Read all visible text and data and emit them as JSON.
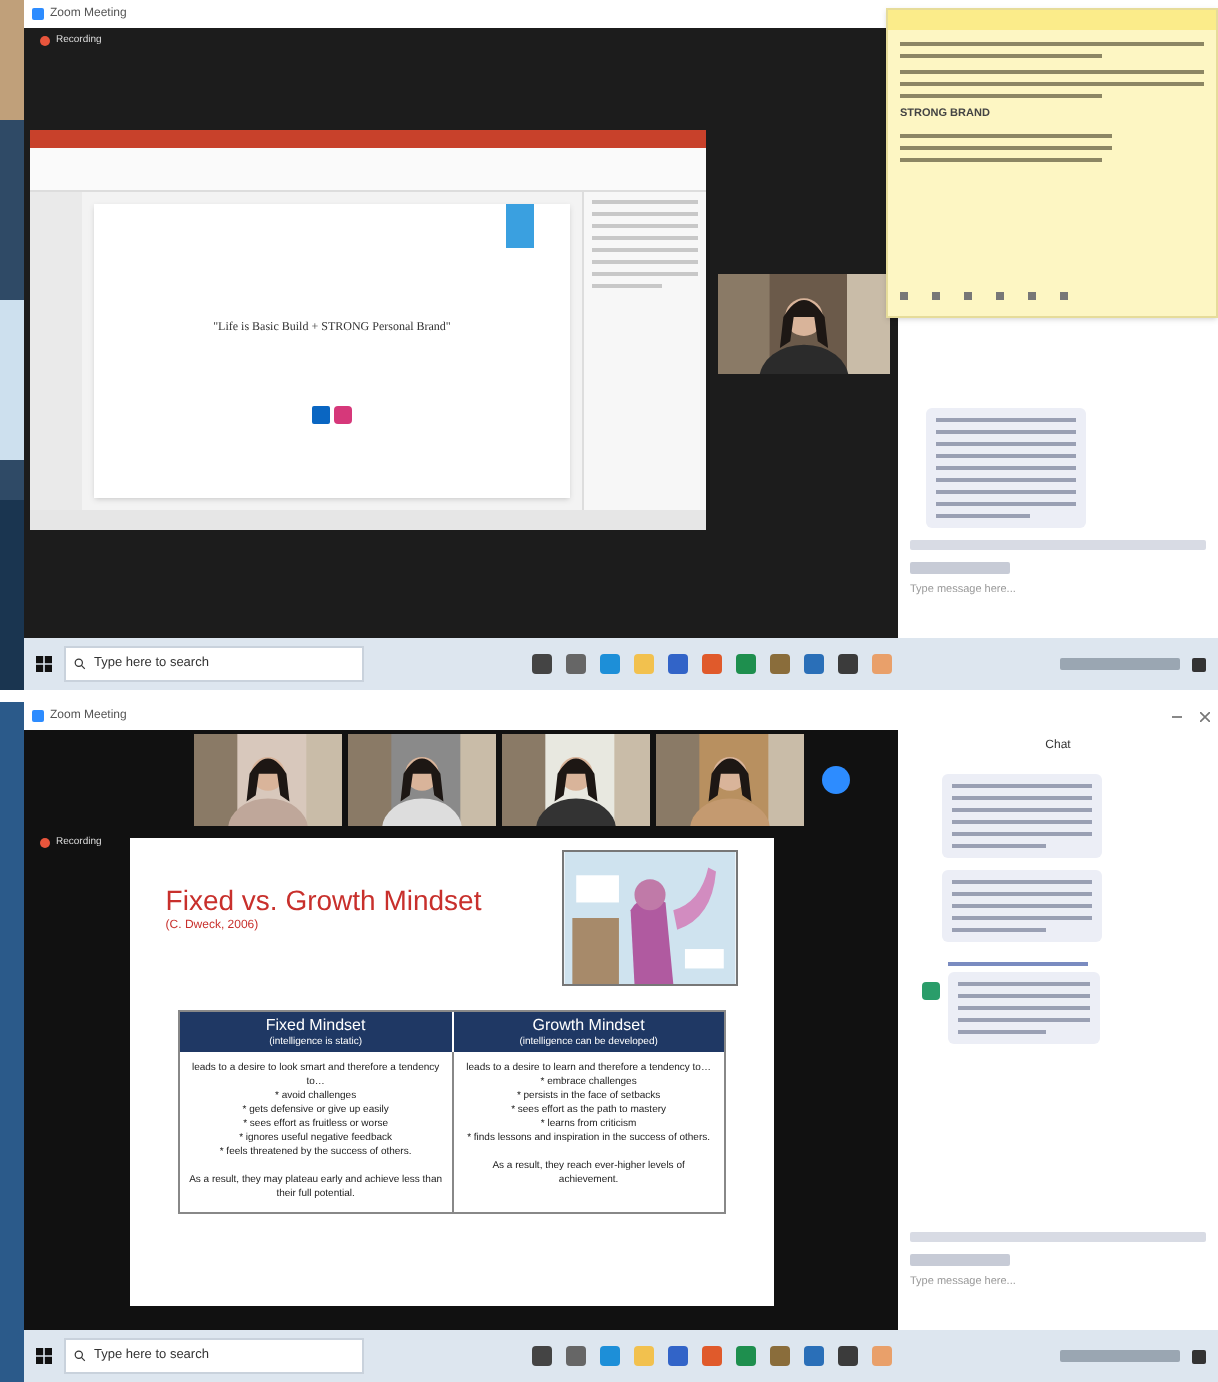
{
  "top_screenshot": {
    "window_title": "Zoom Meeting",
    "recording_label": "Recording",
    "slide": {
      "quote": "\"Life is Basic Build + STRONG Personal Brand\""
    },
    "sticky_note": {
      "heading": "STRONG BRAND"
    },
    "chat": {
      "input_placeholder": "Type message here..."
    },
    "taskbar": {
      "search_placeholder": "Type here to search"
    }
  },
  "bottom_screenshot": {
    "window_title": "Zoom Meeting",
    "recording_label": "Recording",
    "chat_title": "Chat",
    "slide": {
      "title": "Fixed vs. Growth Mindset",
      "subtitle": "(C. Dweck, 2006)",
      "columns": [
        {
          "heading": "Fixed Mindset",
          "subheading": "(intelligence is static)",
          "lead": "leads to a desire to look smart and therefore a tendency to…",
          "points": [
            "* avoid challenges",
            "* gets defensive or give up easily",
            "* sees effort as fruitless or worse",
            "* ignores useful negative feedback",
            "* feels threatened by the success of others."
          ],
          "result": "As a result, they may plateau early and achieve less than their full potential."
        },
        {
          "heading": "Growth Mindset",
          "subheading": "(intelligence can be developed)",
          "lead": "leads to a desire to learn and therefore a tendency to…",
          "points": [
            "* embrace challenges",
            "* persists in the face of setbacks",
            "* sees effort as the path to mastery",
            "* learns from criticism",
            "* finds lessons and inspiration in the success of others."
          ],
          "result": "As a result, they reach ever-higher levels of achievement."
        }
      ]
    },
    "chat": {
      "input_placeholder": "Type message here..."
    },
    "taskbar": {
      "search_placeholder": "Type here to search"
    }
  }
}
